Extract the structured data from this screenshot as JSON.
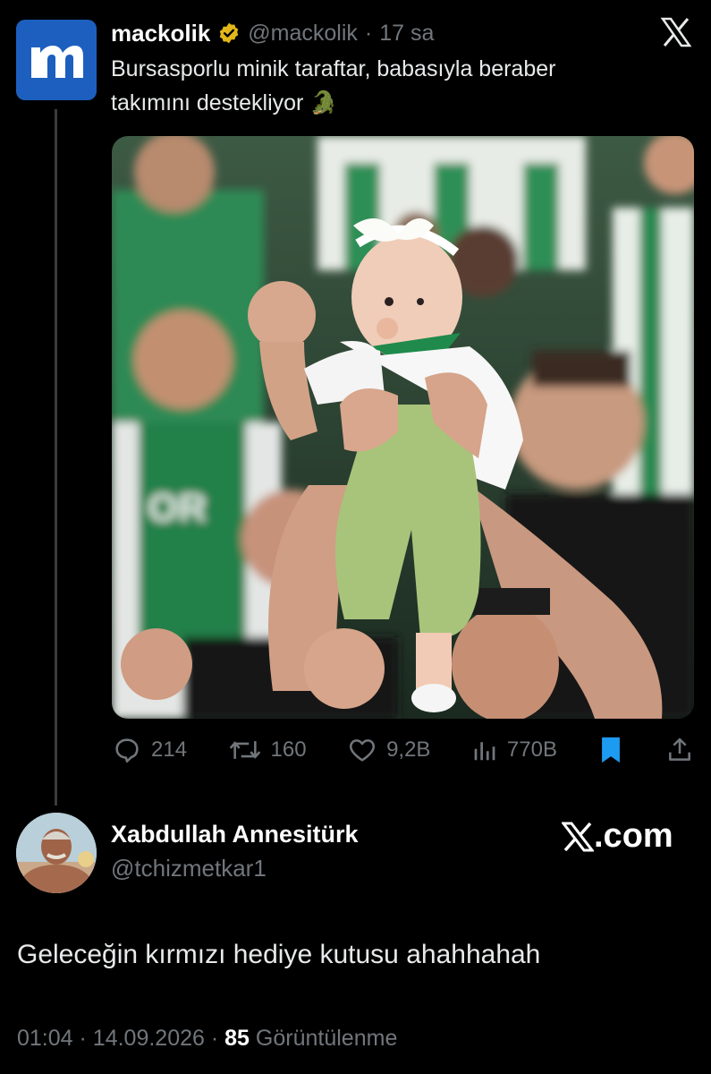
{
  "tweet": {
    "author_name": "mackolik",
    "handle": "@mackolik",
    "separator": "·",
    "time": "17 sa",
    "text_line1": "Bursasporlu minik taraftar, babasıyla beraber",
    "text_line2": "takımını destekliyor",
    "emoji": "🐊",
    "logo_letter": "m",
    "stats": {
      "replies": "214",
      "retweets": "160",
      "likes": "9,2B",
      "views": "770B"
    }
  },
  "reply": {
    "author_name": "Xabdullah Annesitürk",
    "handle": "@tchizmetkar1",
    "brand": ".com",
    "text": "Geleceğin kırmızı hediye kutusu ahahhahah",
    "time": "01:04",
    "date": "14.09.2026",
    "separator": "·",
    "views": "85",
    "views_label": "Görüntülenme"
  },
  "colors": {
    "background": "#000000",
    "muted": "#71767b",
    "brand_blue": "#1d5fbf",
    "bookmark_blue": "#1d9bf0",
    "verified_gold": "#e2b719"
  }
}
